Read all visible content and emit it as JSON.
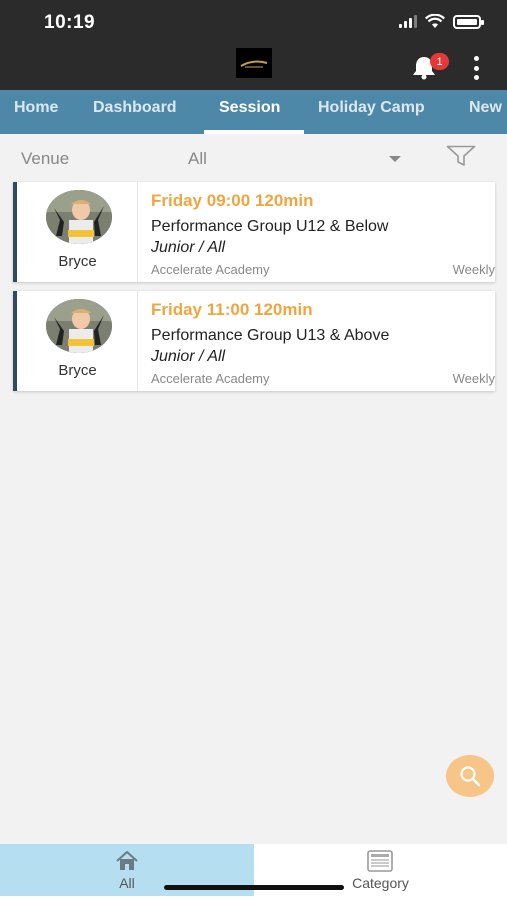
{
  "status_bar": {
    "time": "10:19"
  },
  "header": {
    "notification_count": "1"
  },
  "nav": {
    "tabs": [
      {
        "label": "Home",
        "active": false
      },
      {
        "label": "Dashboard",
        "active": false
      },
      {
        "label": "Session",
        "active": true
      },
      {
        "label": "Holiday Camp",
        "active": false
      },
      {
        "label": "New",
        "active": false
      }
    ]
  },
  "filter": {
    "label": "Venue",
    "value": "All"
  },
  "sessions": [
    {
      "coach": "Bryce",
      "time": "Friday 09:00 120min",
      "title": "Performance Group U12 & Below",
      "level": "Junior / All",
      "venue": "Accelerate Academy",
      "frequency": "Weekly"
    },
    {
      "coach": "Bryce",
      "time": "Friday 11:00 120min",
      "title": "Performance Group U13 & Above",
      "level": "Junior / All",
      "venue": "Accelerate Academy",
      "frequency": "Weekly"
    }
  ],
  "bottom_nav": {
    "all_label": "All",
    "category_label": "Category"
  },
  "colors": {
    "nav_bg": "#4e88a8",
    "accent_orange": "#f0a640",
    "active_bottom_tab": "#b5dff0",
    "fab": "#f6c587"
  }
}
